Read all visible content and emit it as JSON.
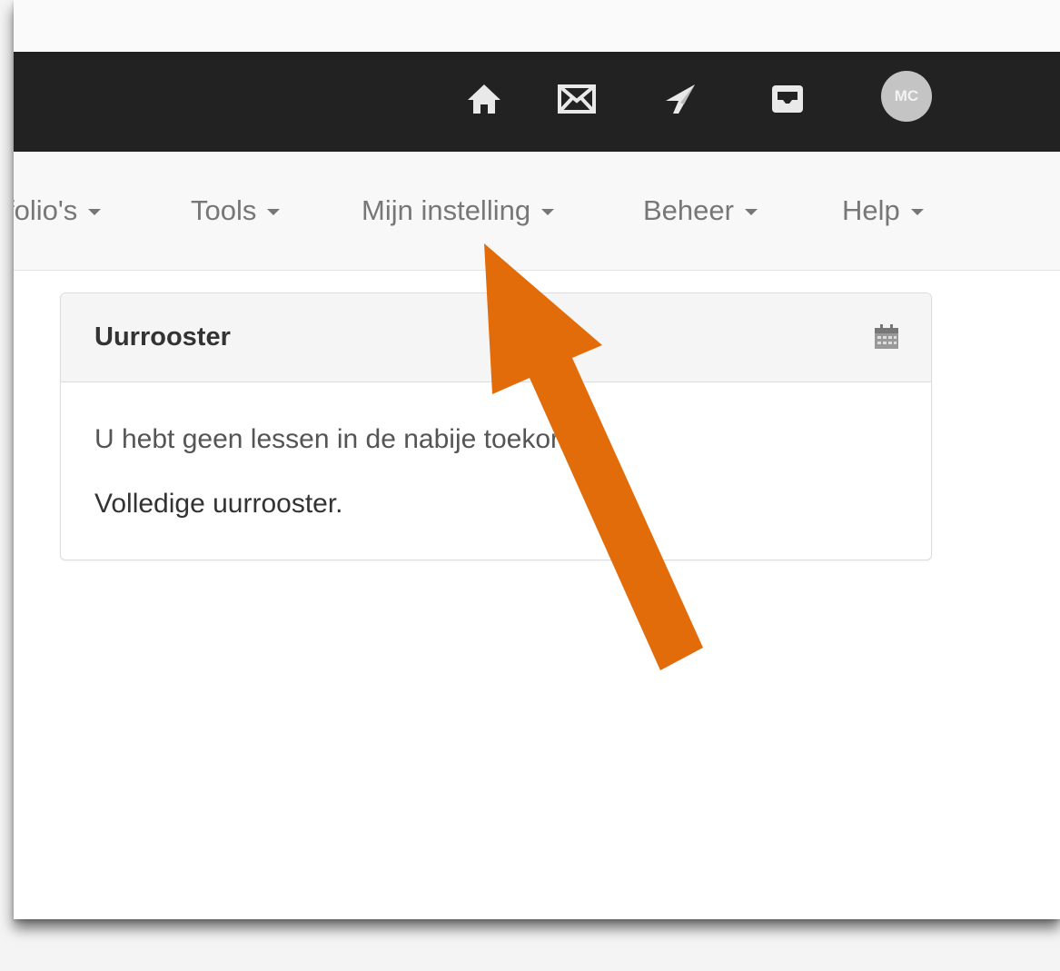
{
  "topbar": {
    "icons": [
      "home-icon",
      "envelope-icon",
      "send-icon",
      "inbox-icon"
    ],
    "avatar_initials": "MC"
  },
  "navbar": {
    "items": [
      {
        "label": "folio's"
      },
      {
        "label": "Tools"
      },
      {
        "label": "Mijn instelling"
      },
      {
        "label": "Beheer"
      },
      {
        "label": "Help"
      }
    ]
  },
  "panel": {
    "title": "Uurrooster",
    "icon": "calendar-icon",
    "message": "U hebt geen lessen in de nabije toekomst.",
    "link": "Volledige uurrooster."
  },
  "annotation": {
    "arrow_color": "#E36C0A",
    "arrow_icon": "arrow-pointer-icon"
  }
}
